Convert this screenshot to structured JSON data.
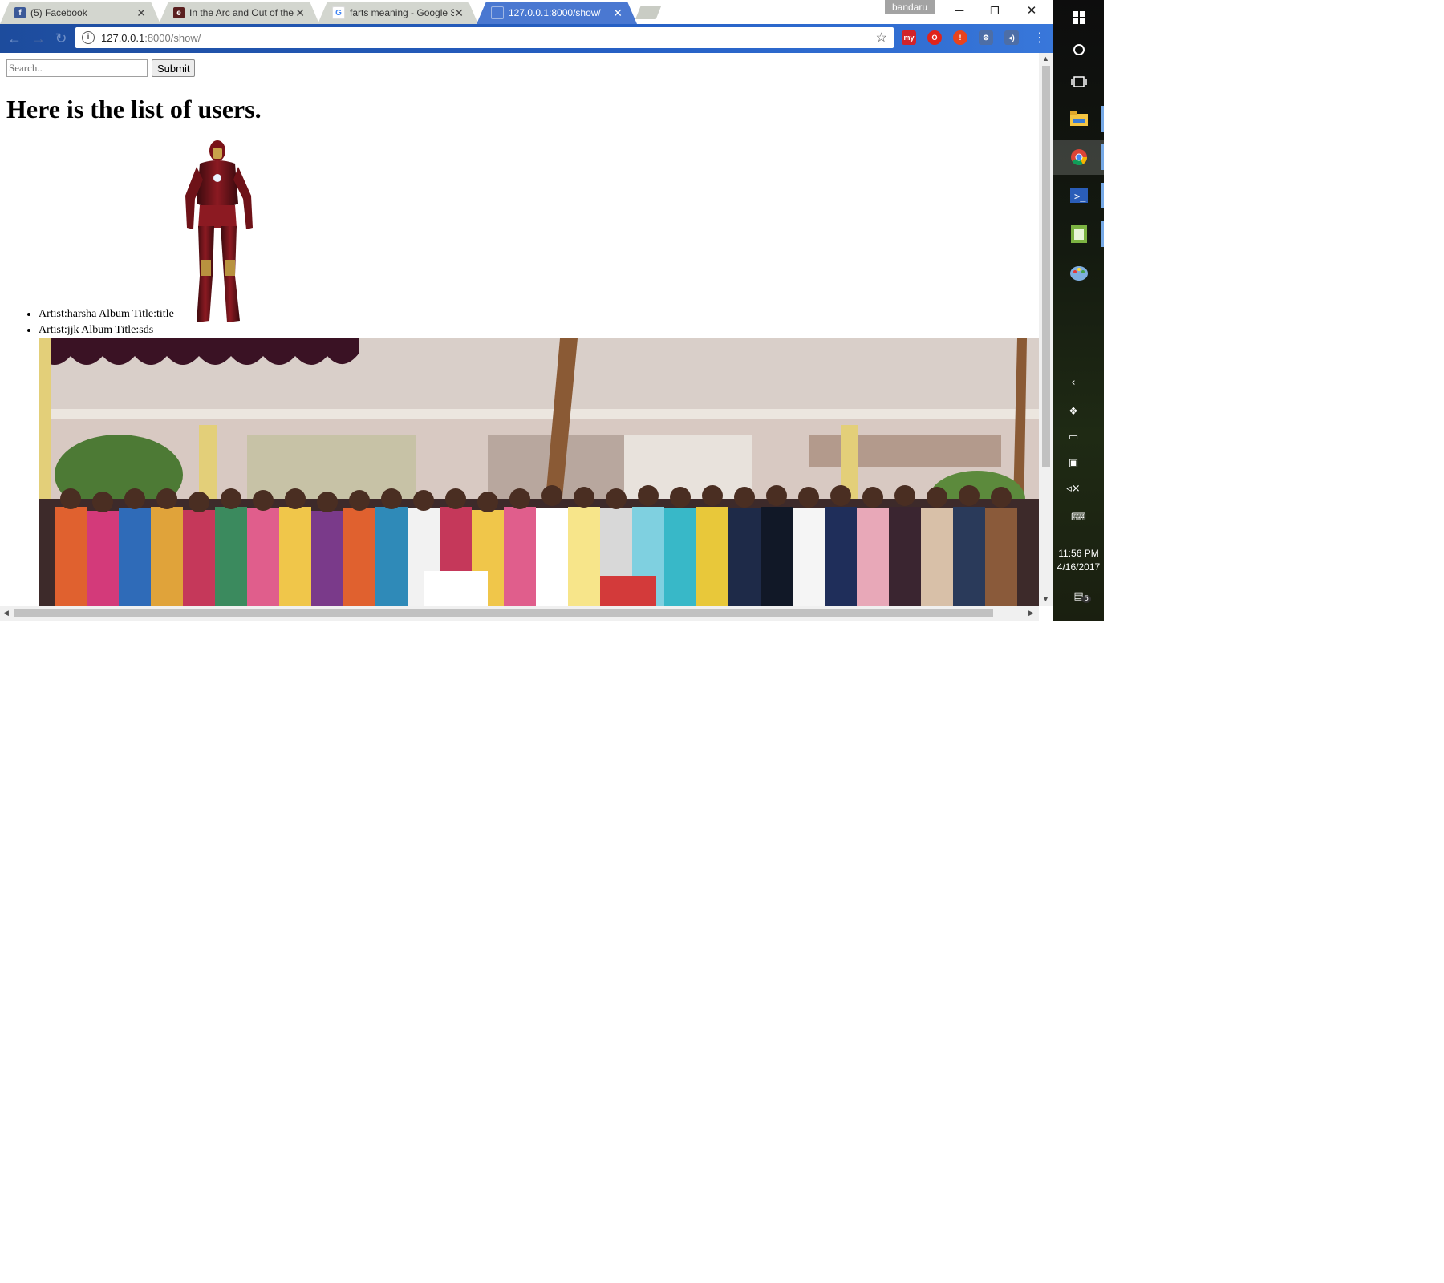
{
  "browser": {
    "tabs": [
      {
        "title": "(5) Facebook",
        "favicon": "facebook-icon",
        "favicon_color": "#3b5998",
        "favicon_glyph": "f",
        "active": false
      },
      {
        "title": "In the Arc and Out of the",
        "favicon": "site-e-icon",
        "favicon_color": "#5a1f1f",
        "favicon_glyph": "e",
        "active": false
      },
      {
        "title": "farts meaning - Google S",
        "favicon": "google-icon",
        "favicon_color": "#4285f4",
        "favicon_glyph": "G",
        "active": false
      },
      {
        "title": "127.0.0.1:8000/show/",
        "favicon": "page-icon",
        "favicon_color": "#6f8fc7",
        "favicon_glyph": "",
        "active": true
      }
    ],
    "profile_name": "bandaru",
    "url_host": "127.0.0.1",
    "url_path": ":8000/show/",
    "extensions": [
      {
        "name": "my-extension-icon",
        "label": "my",
        "color": "#d2232a"
      },
      {
        "name": "opera-extension-icon",
        "label": "O",
        "color": "#e0241b"
      },
      {
        "name": "alert-extension-icon",
        "label": "!",
        "color": "#e8431c"
      },
      {
        "name": "settings-extension-icon",
        "label": "⚙",
        "color": "#4d6ea6"
      },
      {
        "name": "speaker-extension-icon",
        "label": "◂)",
        "color": "#4d6ea6"
      }
    ]
  },
  "page": {
    "search_placeholder": "Search..",
    "submit_label": "Submit",
    "title": "Here is the list of users.",
    "users": [
      {
        "text": "Artist:harsha Album Title:title"
      },
      {
        "text": "Artist:jjk Album Title:sds"
      }
    ]
  },
  "taskbar": {
    "time": "11:56 PM",
    "date": "4/16/2017",
    "notification_count": "5",
    "apps": [
      "file-explorer-icon",
      "chrome-icon",
      "powershell-icon",
      "spreadsheet-icon",
      "paint-icon"
    ]
  }
}
